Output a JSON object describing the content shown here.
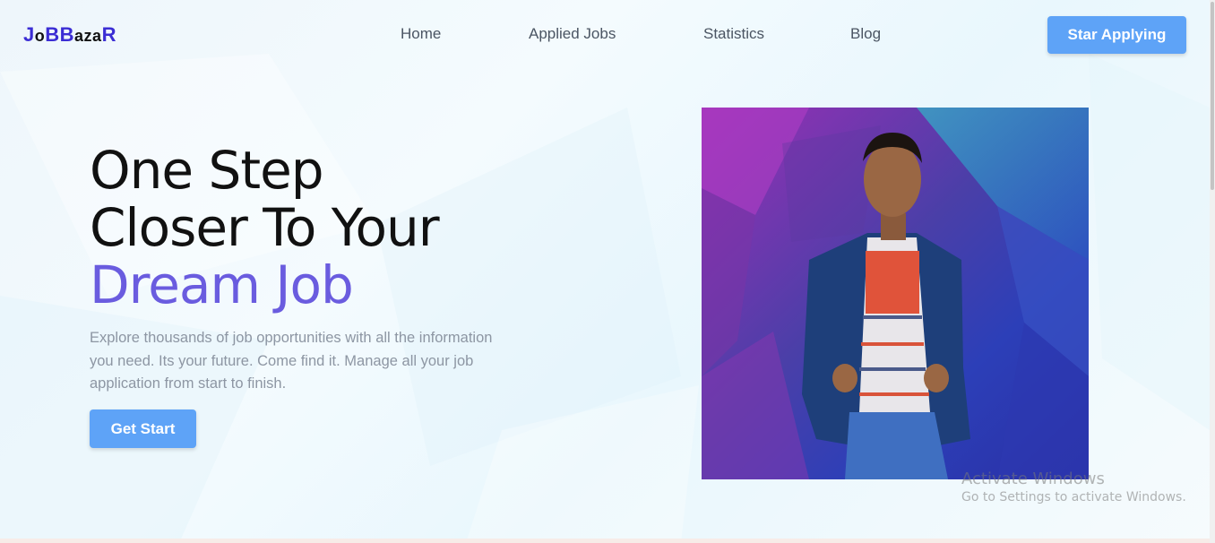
{
  "logo": {
    "parts": [
      "J",
      "o",
      "BB",
      "aza",
      "R"
    ]
  },
  "nav": {
    "items": [
      {
        "label": "Home"
      },
      {
        "label": "Applied Jobs"
      },
      {
        "label": "Statistics"
      },
      {
        "label": "Blog"
      }
    ],
    "cta_label": "Star Applying"
  },
  "hero": {
    "title_line1": "One Step",
    "title_line2": "Closer To Your",
    "title_accent": "Dream Job",
    "description": "Explore thousands of job opportunities with all the information you need. Its your future. Come find it. Manage all your job application from start to finish.",
    "cta_label": "Get Start"
  },
  "watermark": {
    "title": "Activate Windows",
    "subtitle": "Go to Settings to activate Windows."
  },
  "colors": {
    "accent": "#6a5cdf",
    "button": "#5ea3f7",
    "logo_accent": "#3b2dd4"
  }
}
